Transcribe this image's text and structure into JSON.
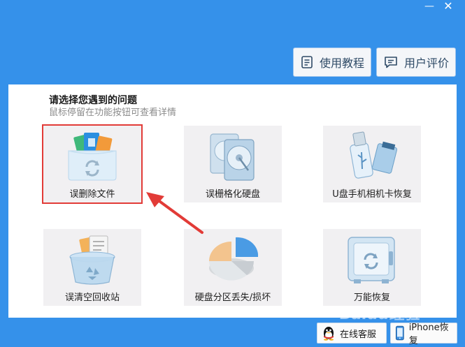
{
  "window": {
    "minimize_glyph": "—",
    "close_glyph": "✕"
  },
  "toolbar": {
    "tutorial_label": "使用教程",
    "review_label": "用户评价"
  },
  "header": {
    "title": "请选择您遇到的问题",
    "subtitle": "鼠标停留在功能按钮可查看详情"
  },
  "tiles": [
    {
      "label": "误删除文件",
      "icon": "folder-files-icon",
      "selected": true
    },
    {
      "label": "误栅格化硬盘",
      "icon": "hard-disk-icon",
      "selected": false
    },
    {
      "label": "U盘手机相机卡恢复",
      "icon": "usb-sdcard-icon",
      "selected": false
    },
    {
      "label": "误清空回收站",
      "icon": "recycle-bin-icon",
      "selected": false
    },
    {
      "label": "硬盘分区丢失/损坏",
      "icon": "pie-partition-icon",
      "selected": false
    },
    {
      "label": "万能恢复",
      "icon": "safe-box-icon",
      "selected": false
    }
  ],
  "footer": {
    "service_label": "在线客服",
    "iphone_label": "iPhone恢复"
  },
  "watermark": "Baidu经验",
  "colors": {
    "background": "#3591ea",
    "panel": "#ffffff",
    "tile": "#f1f0f2",
    "highlight": "#e23b37"
  }
}
